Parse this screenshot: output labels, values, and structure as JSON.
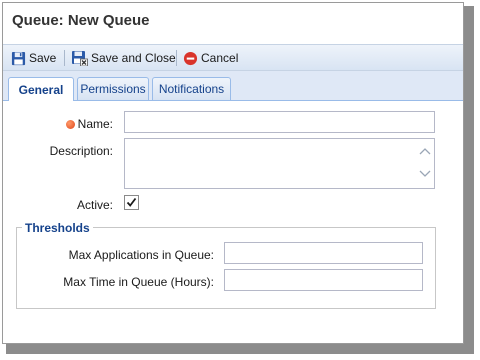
{
  "title": "Queue: New Queue",
  "toolbar": {
    "save_label": "Save",
    "save_close_label": "Save and Close",
    "cancel_label": "Cancel"
  },
  "tabs": [
    {
      "label": "General"
    },
    {
      "label": "Permissions"
    },
    {
      "label": "Notifications"
    }
  ],
  "form": {
    "name_label": "Name:",
    "name_value": "",
    "description_label": "Description:",
    "description_value": "",
    "active_label": "Active:",
    "active_checked": true
  },
  "thresholds": {
    "legend": "Thresholds",
    "max_apps_label": "Max Applications in Queue:",
    "max_apps_value": "",
    "max_time_label": "Max Time in Queue (Hours):",
    "max_time_value": ""
  },
  "colors": {
    "accent": "#15428b",
    "required": "#e0461a",
    "cancel": "#d9342b"
  }
}
